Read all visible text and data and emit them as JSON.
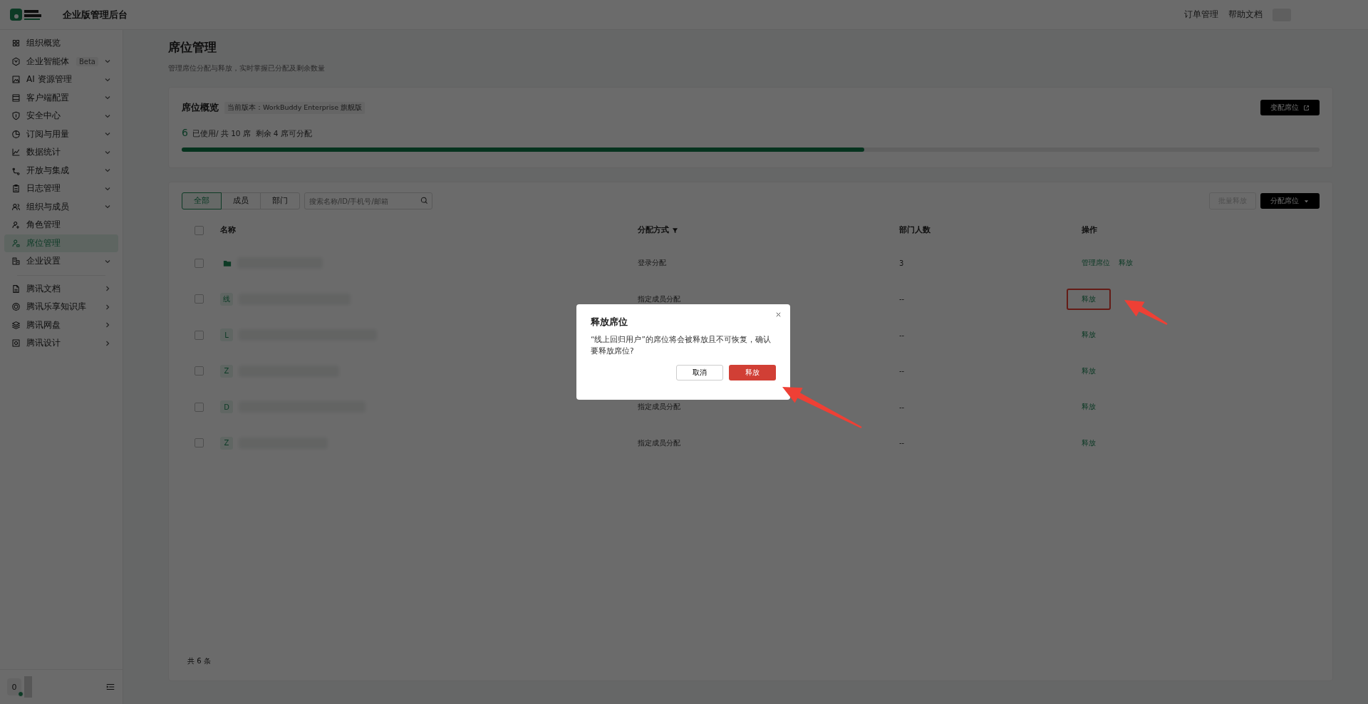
{
  "header": {
    "title": "企业版管理后台",
    "links": [
      "订单管理",
      "帮助文档"
    ]
  },
  "sidebar": {
    "sections": [
      {
        "kind": "menu",
        "items": [
          {
            "label": "组织概览",
            "has_submenu": false,
            "selected": false
          },
          {
            "label": "企业智能体",
            "badge": "Beta",
            "has_submenu": true,
            "selected": false
          },
          {
            "label": "AI 资源管理",
            "has_submenu": true,
            "selected": false
          },
          {
            "label": "客户端配置",
            "has_submenu": true,
            "selected": false
          },
          {
            "label": "安全中心",
            "has_submenu": true,
            "selected": false
          },
          {
            "label": "订阅与用量",
            "has_submenu": true,
            "selected": false
          },
          {
            "label": "数据统计",
            "has_submenu": true,
            "selected": false
          },
          {
            "label": "开放与集成",
            "has_submenu": true,
            "selected": false
          },
          {
            "label": "日志管理",
            "has_submenu": true,
            "selected": false
          },
          {
            "label": "组织与成员",
            "has_submenu": true,
            "selected": false
          },
          {
            "label": "角色管理",
            "has_submenu": false,
            "selected": false
          },
          {
            "label": "席位管理",
            "has_submenu": false,
            "selected": true
          },
          {
            "label": "企业设置",
            "has_submenu": true,
            "selected": false
          }
        ]
      },
      {
        "kind": "links",
        "items": [
          {
            "label": "腾讯文档",
            "has_submenu": true,
            "selected": false
          },
          {
            "label": "腾讯乐享知识库",
            "has_submenu": true,
            "selected": false
          },
          {
            "label": "腾讯网盘",
            "has_submenu": true,
            "selected": false
          },
          {
            "label": "腾讯设计",
            "has_submenu": true,
            "selected": false
          }
        ]
      }
    ],
    "user": {
      "avatar": "0",
      "online": true
    }
  },
  "page": {
    "title": "席位管理",
    "subtitle": "管理席位分配与释放，实时掌握已分配及剩余数量"
  },
  "overview": {
    "title": "席位概览",
    "version": "当前版本：WorkBuddy Enterprise 旗舰版",
    "used": "6",
    "usage": "已使用/ 共 10 席  剩余 4 席可分配",
    "level": 0.6,
    "button": "变配席位"
  },
  "toolbar": {
    "tabs": [
      {
        "label": "全部",
        "selected": true
      },
      {
        "label": "成员",
        "selected": false
      },
      {
        "label": "部门",
        "selected": false
      }
    ],
    "search": {
      "placeholder": "搜索名称/ID/手机号/邮箱"
    },
    "batch_button": {
      "label": "批量释放",
      "disabled": true
    },
    "assign_button": {
      "label": "分配席位"
    }
  },
  "table": {
    "all_checked": false,
    "columns": [
      {
        "label": "名称",
        "kind": "plain"
      },
      {
        "label": "分配方式",
        "kind": "filter"
      },
      {
        "label": "部门人数",
        "kind": "plain"
      },
      {
        "label": "操作",
        "kind": "plain"
      }
    ],
    "rows": [
      {
        "checked": false,
        "avatar": {
          "kind": "folder"
        },
        "method": "登录分配",
        "count": "3",
        "actions": [
          {
            "label": "管理席位",
            "highlighted": false
          },
          {
            "label": "释放",
            "highlighted": false
          }
        ]
      },
      {
        "checked": false,
        "avatar": {
          "kind": "letter",
          "text": "线"
        },
        "method": "指定成员分配",
        "count": "--",
        "actions": [
          {
            "label": "释放",
            "highlighted": true
          }
        ]
      },
      {
        "checked": false,
        "avatar": {
          "kind": "letter",
          "text": "L"
        },
        "count": "--",
        "actions": [
          {
            "label": "释放",
            "highlighted": false
          }
        ]
      },
      {
        "checked": false,
        "avatar": {
          "kind": "letter",
          "text": "Z"
        },
        "count": "--",
        "actions": [
          {
            "label": "释放",
            "highlighted": false
          }
        ]
      },
      {
        "checked": false,
        "avatar": {
          "kind": "letter",
          "text": "D"
        },
        "method": "指定成员分配",
        "count": "--",
        "actions": [
          {
            "label": "释放",
            "highlighted": false
          }
        ]
      },
      {
        "checked": false,
        "avatar": {
          "kind": "letter",
          "text": "Z"
        },
        "method": "指定成员分配",
        "count": "--",
        "actions": [
          {
            "label": "释放",
            "highlighted": false
          }
        ]
      }
    ],
    "total": "共 6 条"
  },
  "dialog": {
    "title": "释放席位",
    "message": "“线上回归用户”的席位将会被释放且不可恢复，确认要释放席位?",
    "cancel": "取消",
    "confirm": "释放"
  }
}
